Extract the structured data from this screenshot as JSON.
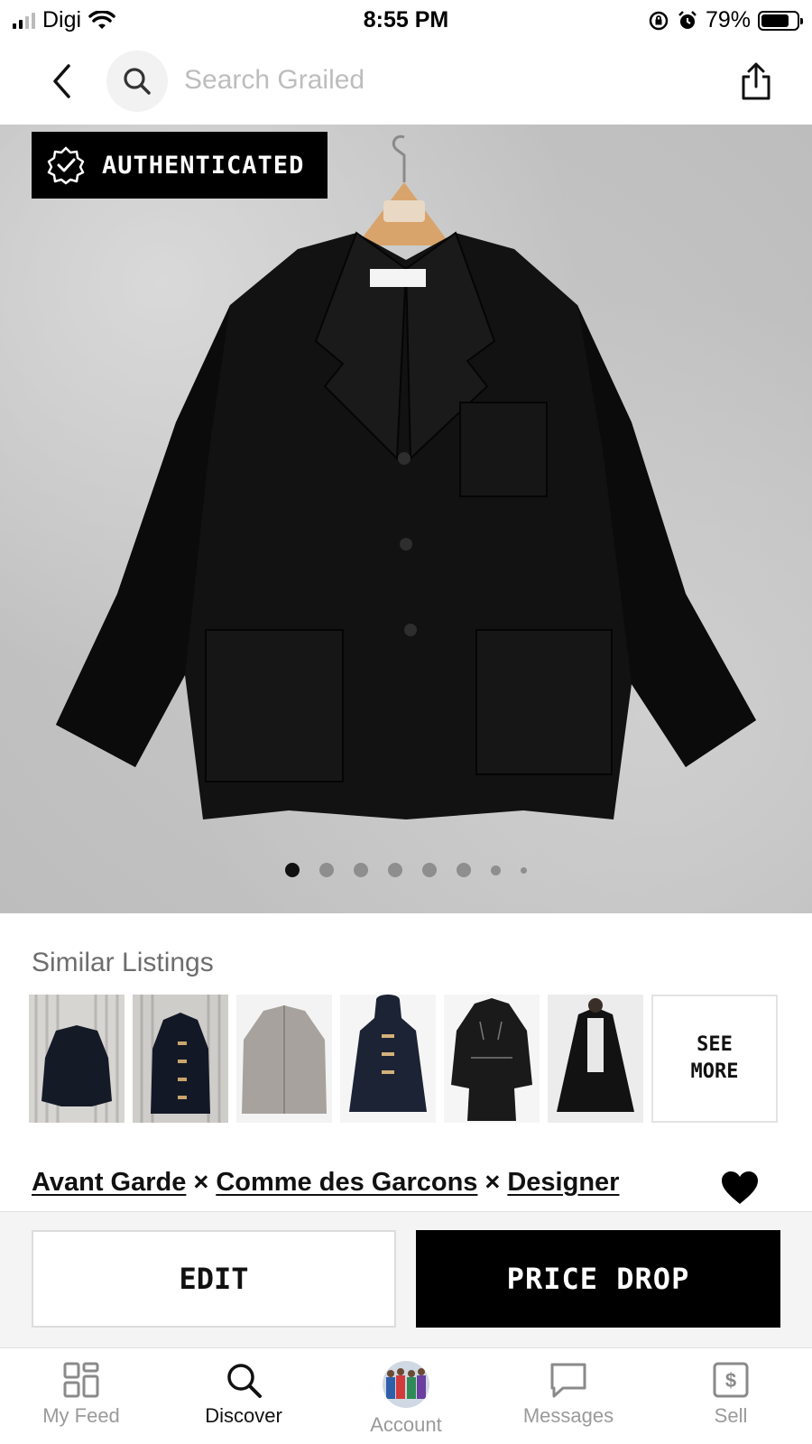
{
  "status_bar": {
    "carrier": "Digi",
    "time": "8:55 PM",
    "battery": "79%",
    "battery_level": 0.79
  },
  "nav": {
    "search_placeholder": "Search Grailed"
  },
  "hero": {
    "badge": "AUTHENTICATED",
    "photo_count": 8,
    "current_photo": 1
  },
  "similar": {
    "title": "Similar Listings",
    "see_more": "SEE\nMORE"
  },
  "designers": {
    "items": [
      "Avant Garde",
      "Comme des Garcons",
      "Designer"
    ],
    "separator": "×"
  },
  "actions": {
    "edit": "EDIT",
    "price_drop": "PRICE DROP"
  },
  "tabs": [
    {
      "label": "My Feed",
      "icon": "grid-icon"
    },
    {
      "label": "Discover",
      "icon": "search-icon",
      "active": true
    },
    {
      "label": "Account",
      "icon": "avatar"
    },
    {
      "label": "Messages",
      "icon": "chat-bubble-icon"
    },
    {
      "label": "Sell",
      "icon": "dollar-tag-icon"
    }
  ],
  "colors": {
    "accent": "#000000",
    "muted_text": "#9a9a9a"
  }
}
